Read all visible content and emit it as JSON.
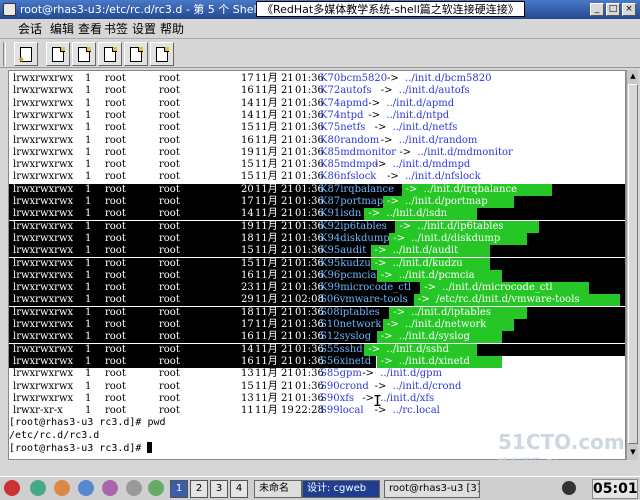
{
  "window": {
    "title": "root@rhas3-u3:/etc/rc.d/rc3.d - 第 5 个 Shell - Konsole",
    "note": "《RedHat多媒体教学系统-shell篇之软连接硬连接》"
  },
  "menu": [
    "会话",
    "编辑",
    "查看",
    "书签",
    "设置",
    "帮助"
  ],
  "toolbar_buttons": [
    "new-session-button",
    "session-1-button",
    "session-2-button",
    "session-3-button",
    "session-4-button"
  ],
  "listing": [
    {
      "perm": "lrwxrwxrwx",
      "n": "1",
      "owner": "root",
      "group": "root",
      "size": "17",
      "month": "11月",
      "day": "21",
      "time": "01:36",
      "name": "K70bcm5820",
      "arrow": "->",
      "target": "../init.d/bcm5820",
      "sel": false
    },
    {
      "perm": "lrwxrwxrwx",
      "n": "1",
      "owner": "root",
      "group": "root",
      "size": "16",
      "month": "11月",
      "day": "21",
      "time": "01:36",
      "name": "K72autofs",
      "arrow": "->",
      "target": "../init.d/autofs",
      "sel": false
    },
    {
      "perm": "lrwxrwxrwx",
      "n": "1",
      "owner": "root",
      "group": "root",
      "size": "14",
      "month": "11月",
      "day": "21",
      "time": "01:36",
      "name": "K74apmd",
      "arrow": "->",
      "target": "../init.d/apmd",
      "sel": false
    },
    {
      "perm": "lrwxrwxrwx",
      "n": "1",
      "owner": "root",
      "group": "root",
      "size": "14",
      "month": "11月",
      "day": "21",
      "time": "01:36",
      "name": "K74ntpd",
      "arrow": "->",
      "target": "../init.d/ntpd",
      "sel": false
    },
    {
      "perm": "lrwxrwxrwx",
      "n": "1",
      "owner": "root",
      "group": "root",
      "size": "15",
      "month": "11月",
      "day": "21",
      "time": "01:36",
      "name": "K75netfs",
      "arrow": "->",
      "target": "../init.d/netfs",
      "sel": false
    },
    {
      "perm": "lrwxrwxrwx",
      "n": "1",
      "owner": "root",
      "group": "root",
      "size": "16",
      "month": "11月",
      "day": "21",
      "time": "01:36",
      "name": "K80random",
      "arrow": "->",
      "target": "../init.d/random",
      "sel": false
    },
    {
      "perm": "lrwxrwxrwx",
      "n": "1",
      "owner": "root",
      "group": "root",
      "size": "19",
      "month": "11月",
      "day": "21",
      "time": "01:36",
      "name": "K85mdmonitor",
      "arrow": "->",
      "target": "../init.d/mdmonitor",
      "sel": false
    },
    {
      "perm": "lrwxrwxrwx",
      "n": "1",
      "owner": "root",
      "group": "root",
      "size": "15",
      "month": "11月",
      "day": "21",
      "time": "01:36",
      "name": "K85mdmpd",
      "arrow": "->",
      "target": "../init.d/mdmpd",
      "sel": false
    },
    {
      "perm": "lrwxrwxrwx",
      "n": "1",
      "owner": "root",
      "group": "root",
      "size": "15",
      "month": "11月",
      "day": "21",
      "time": "01:36",
      "name": "K86nfslock",
      "arrow": "->",
      "target": "../init.d/nfslock",
      "sel": false
    },
    {
      "perm": "lrwxrwxrwx",
      "n": "1",
      "owner": "root",
      "group": "root",
      "size": "20",
      "month": "11月",
      "day": "21",
      "time": "01:36",
      "name": "K87irqbalance",
      "arrow": "->",
      "target": "../init.d/irqbalance",
      "sel": true
    },
    {
      "perm": "lrwxrwxrwx",
      "n": "1",
      "owner": "root",
      "group": "root",
      "size": "17",
      "month": "11月",
      "day": "21",
      "time": "01:36",
      "name": "K87portmap",
      "arrow": "->",
      "target": "../init.d/portmap",
      "sel": true
    },
    {
      "perm": "lrwxrwxrwx",
      "n": "1",
      "owner": "root",
      "group": "root",
      "size": "14",
      "month": "11月",
      "day": "21",
      "time": "01:36",
      "name": "K91isdn",
      "arrow": "->",
      "target": "../init.d/isdn",
      "sel": true
    },
    {
      "perm": "lrwxrwxrwx",
      "n": "1",
      "owner": "root",
      "group": "root",
      "size": "19",
      "month": "11月",
      "day": "21",
      "time": "01:36",
      "name": "K92ip6tables",
      "arrow": "->",
      "target": "../init.d/ip6tables",
      "sel": true
    },
    {
      "perm": "lrwxrwxrwx",
      "n": "1",
      "owner": "root",
      "group": "root",
      "size": "18",
      "month": "11月",
      "day": "21",
      "time": "01:36",
      "name": "K94diskdump",
      "arrow": "->",
      "target": "../init.d/diskdump",
      "sel": true
    },
    {
      "perm": "lrwxrwxrwx",
      "n": "1",
      "owner": "root",
      "group": "root",
      "size": "15",
      "month": "11月",
      "day": "21",
      "time": "01:36",
      "name": "K95audit",
      "arrow": "->",
      "target": "../init.d/audit",
      "sel": true
    },
    {
      "perm": "lrwxrwxrwx",
      "n": "1",
      "owner": "root",
      "group": "root",
      "size": "15",
      "month": "11月",
      "day": "21",
      "time": "01:36",
      "name": "K95kudzu",
      "arrow": "->",
      "target": "../init.d/kudzu",
      "sel": true
    },
    {
      "perm": "lrwxrwxrwx",
      "n": "1",
      "owner": "root",
      "group": "root",
      "size": "16",
      "month": "11月",
      "day": "21",
      "time": "01:36",
      "name": "K96pcmcia",
      "arrow": "->",
      "target": "../init.d/pcmcia",
      "sel": true
    },
    {
      "perm": "lrwxrwxrwx",
      "n": "1",
      "owner": "root",
      "group": "root",
      "size": "23",
      "month": "11月",
      "day": "21",
      "time": "01:36",
      "name": "K99microcode_ctl",
      "arrow": "->",
      "target": "../init.d/microcode_ctl",
      "sel": true
    },
    {
      "perm": "lrwxrwxrwx",
      "n": "1",
      "owner": "root",
      "group": "root",
      "size": "29",
      "month": "11月",
      "day": "21",
      "time": "02:08",
      "name": "S06vmware-tools",
      "arrow": "->",
      "target": "/etc/rc.d/init.d/vmware-tools",
      "sel": true
    },
    {
      "perm": "lrwxrwxrwx",
      "n": "1",
      "owner": "root",
      "group": "root",
      "size": "18",
      "month": "11月",
      "day": "21",
      "time": "01:36",
      "name": "S08iptables",
      "arrow": "->",
      "target": "../init.d/iptables",
      "sel": true
    },
    {
      "perm": "lrwxrwxrwx",
      "n": "1",
      "owner": "root",
      "group": "root",
      "size": "17",
      "month": "11月",
      "day": "21",
      "time": "01:36",
      "name": "S10network",
      "arrow": "->",
      "target": "../init.d/network",
      "sel": true
    },
    {
      "perm": "lrwxrwxrwx",
      "n": "1",
      "owner": "root",
      "group": "root",
      "size": "16",
      "month": "11月",
      "day": "21",
      "time": "01:36",
      "name": "S12syslog",
      "arrow": "->",
      "target": "../init.d/syslog",
      "sel": true
    },
    {
      "perm": "lrwxrwxrwx",
      "n": "1",
      "owner": "root",
      "group": "root",
      "size": "14",
      "month": "11月",
      "day": "21",
      "time": "01:36",
      "name": "S55sshd",
      "arrow": "->",
      "target": "../init.d/sshd",
      "sel": true
    },
    {
      "perm": "lrwxrwxrwx",
      "n": "1",
      "owner": "root",
      "group": "root",
      "size": "16",
      "month": "11月",
      "day": "21",
      "time": "01:36",
      "name": "S56xinetd",
      "arrow": "->",
      "target": "../init.d/xinetd",
      "sel": "partial"
    },
    {
      "perm": "lrwxrwxrwx",
      "n": "1",
      "owner": "root",
      "group": "root",
      "size": "13",
      "month": "11月",
      "day": "21",
      "time": "01:36",
      "name": "S85gpm",
      "arrow": "->",
      "target": "../init.d/gpm",
      "sel": false
    },
    {
      "perm": "lrwxrwxrwx",
      "n": "1",
      "owner": "root",
      "group": "root",
      "size": "15",
      "month": "11月",
      "day": "21",
      "time": "01:36",
      "name": "S90crond",
      "arrow": "->",
      "target": "../init.d/crond",
      "sel": false
    },
    {
      "perm": "lrwxrwxrwx",
      "n": "1",
      "owner": "root",
      "group": "root",
      "size": "13",
      "month": "11月",
      "day": "21",
      "time": "01:36",
      "name": "S90xfs",
      "arrow": "->",
      "target": "../init.d/xfs",
      "sel": false
    },
    {
      "perm": "lrwxr-xr-x",
      "n": "1",
      "owner": "root",
      "group": "root",
      "size": "11",
      "month": "11月",
      "day": "19",
      "time": "22:28",
      "name": "S99local",
      "arrow": "->",
      "target": "../rc.local",
      "sel": false
    }
  ],
  "prompts": [
    "[root@rhas3-u3 rc3.d]# pwd",
    "/etc/rc.d/rc3.d",
    "[root@rhas3-u3 rc3.d]# "
  ],
  "watermark": {
    "main": "51CTO.com",
    "sub": "技术博客 Blog"
  },
  "taskbar": {
    "desktops": [
      "1",
      "2",
      "3",
      "4"
    ],
    "tasks": [
      {
        "label": "未命名",
        "active": false
      },
      {
        "label": "设计: cgweb",
        "active": true
      },
      {
        "label": "root@rhas3-u3 [3]",
        "active": false
      }
    ],
    "clock": "05:01"
  }
}
